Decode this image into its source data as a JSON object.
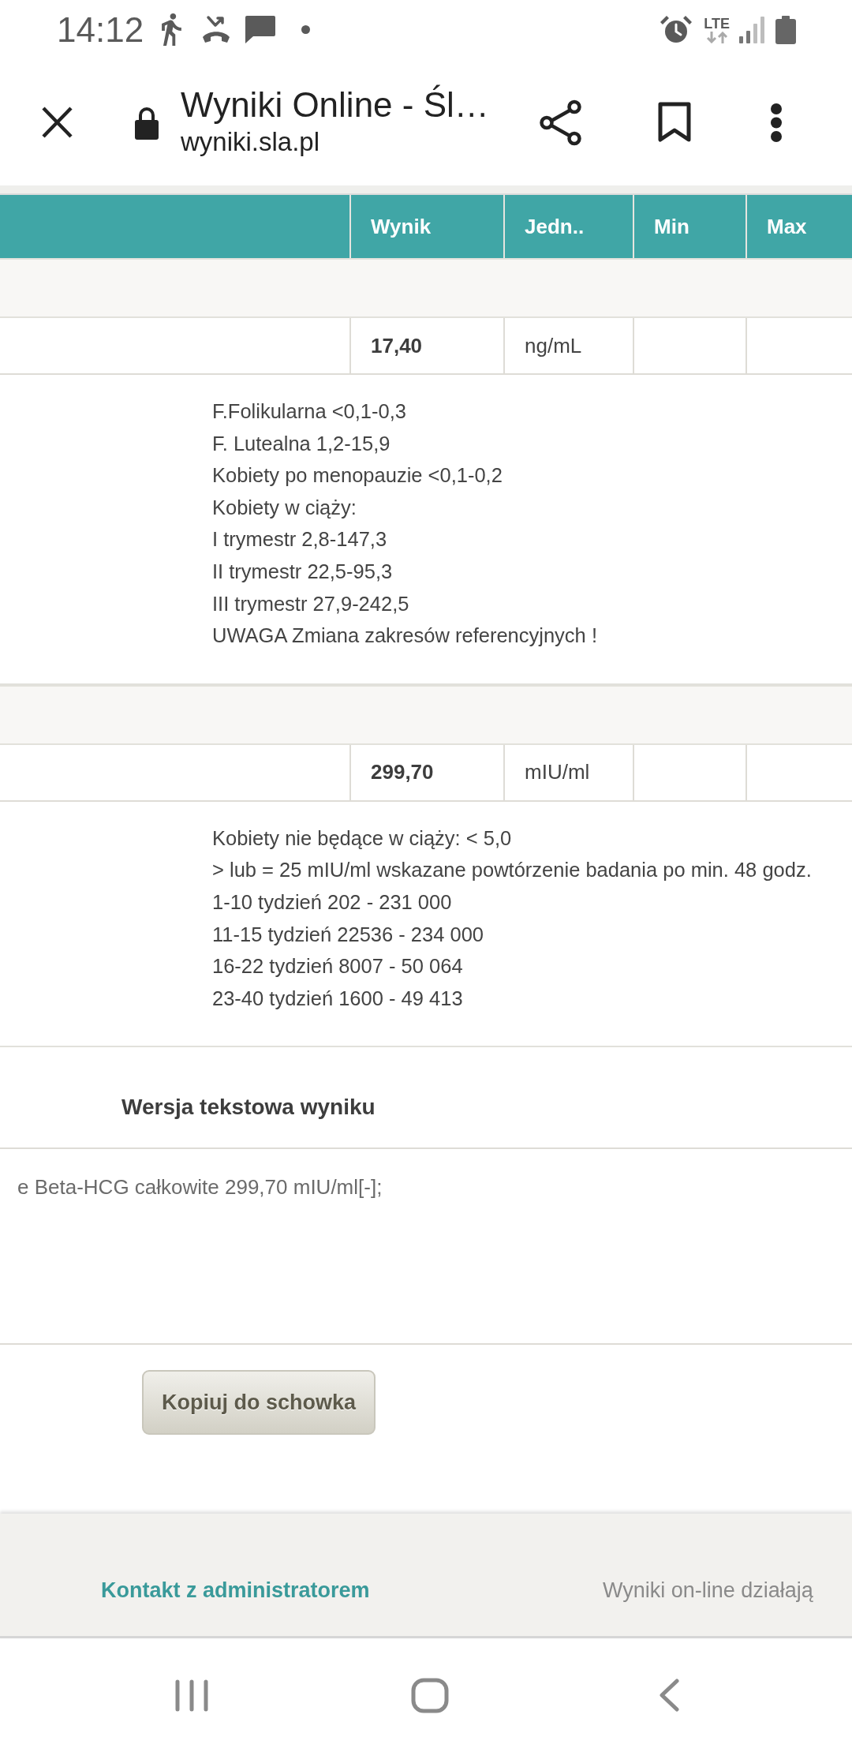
{
  "status_bar": {
    "time": "14:12",
    "network": "LTE"
  },
  "browser": {
    "title": "Wyniki Online - Śl…",
    "url": "wyniki.sla.pl"
  },
  "table": {
    "columns": [
      {
        "label": "Wynik"
      },
      {
        "label": "Jedn.."
      },
      {
        "label": "Min"
      },
      {
        "label": "Max"
      }
    ],
    "results": [
      {
        "value": "17,40",
        "unit": "ng/mL",
        "reference": [
          "F.Folikularna <0,1-0,3",
          "F. Lutealna 1,2-15,9",
          "Kobiety po menopauzie <0,1-0,2",
          "Kobiety w ciąży:",
          "I trymestr 2,8-147,3",
          "II trymestr 22,5-95,3",
          "III trymestr 27,9-242,5",
          "UWAGA Zmiana zakresów referencyjnych !"
        ]
      },
      {
        "value": "299,70",
        "unit": "mIU/ml",
        "reference": [
          "Kobiety nie będące w ciąży: < 5,0",
          "> lub = 25 mIU/ml wskazane powtórzenie badania po min. 48 godz.",
          "1-10 tydzień 202 - 231 000",
          "11-15 tydzień 22536 - 234 000",
          "16-22 tydzień 8007 - 50 064",
          "23-40 tydzień 1600 - 49 413"
        ]
      }
    ]
  },
  "text_version": {
    "heading": "Wersja tekstowa wyniku",
    "value": "e Beta-HCG całkowite 299,70 mIU/ml[-];"
  },
  "copy_button": {
    "label": "Kopiuj do schowka"
  },
  "footer": {
    "contact_link": "Kontakt z administratorem",
    "note": "Wyniki on-line działają"
  }
}
